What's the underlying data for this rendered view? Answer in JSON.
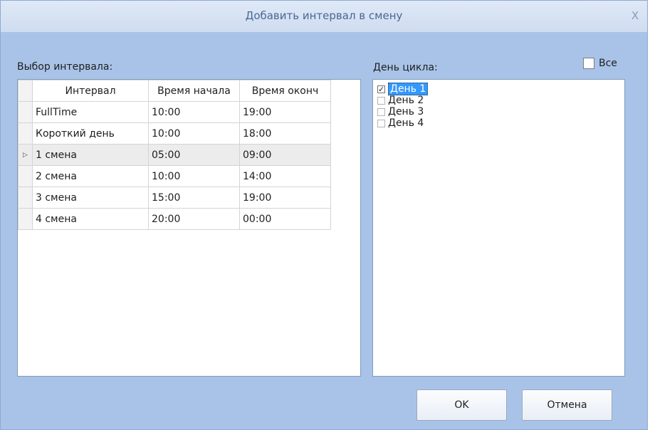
{
  "dialog": {
    "title": "Добавить интервал в смену",
    "close_label": "X"
  },
  "left": {
    "label": "Выбор интервала:",
    "columns": [
      "Интервал",
      "Время начала",
      "Время оконч"
    ],
    "rows": [
      {
        "indicator": "",
        "interval": "FullTime",
        "start": "10:00",
        "end": "19:00"
      },
      {
        "indicator": "",
        "interval": "Короткий день",
        "start": "10:00",
        "end": "18:00"
      },
      {
        "indicator": "▷",
        "interval": "1 смена",
        "start": "05:00",
        "end": "09:00"
      },
      {
        "indicator": "",
        "interval": "2 смена",
        "start": "10:00",
        "end": "14:00"
      },
      {
        "indicator": "",
        "interval": "3 смена",
        "start": "15:00",
        "end": "19:00"
      },
      {
        "indicator": "",
        "interval": "4 смена",
        "start": "20:00",
        "end": "00:00"
      }
    ]
  },
  "right": {
    "label": "День цикла:",
    "all_label": "Все",
    "all_checked": false,
    "items": [
      {
        "label": "День 1",
        "checked": true
      },
      {
        "label": "День 2",
        "checked": false
      },
      {
        "label": "День 3",
        "checked": false
      },
      {
        "label": "День 4",
        "checked": false
      }
    ]
  },
  "buttons": {
    "ok": "OK",
    "cancel": "Отмена"
  }
}
